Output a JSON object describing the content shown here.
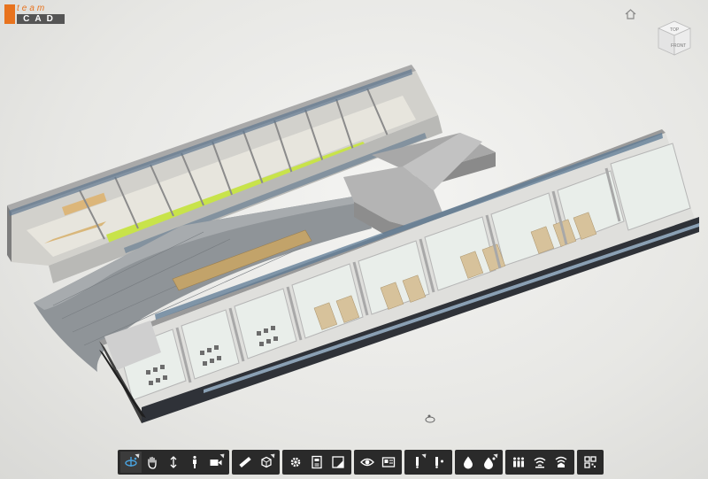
{
  "logo": {
    "word_top": "team",
    "word_bottom": "CAD"
  },
  "view_cube": {
    "top_label": "TOP",
    "front_label": "FRONT"
  },
  "toolbar": {
    "groups": [
      {
        "tools": [
          "orbit-icon",
          "pan-icon",
          "zoom-icon",
          "walk-icon",
          "camera-icon"
        ]
      },
      {
        "tools": [
          "measure-icon",
          "section-box-icon"
        ]
      },
      {
        "tools": [
          "settings-icon",
          "properties-icon",
          "model-browser-icon"
        ]
      },
      {
        "tools": [
          "visibility-icon",
          "sheets-icon"
        ]
      },
      {
        "tools": [
          "marker-icon",
          "marker-list-icon"
        ]
      },
      {
        "tools": [
          "water-drop-icon",
          "water-drop-add-icon"
        ]
      },
      {
        "tools": [
          "people-icon",
          "wifi-icon",
          "wifi-alt-icon"
        ]
      },
      {
        "tools": [
          "qr-code-icon"
        ]
      }
    ],
    "active_tool": "orbit-icon",
    "colors": {
      "bar": "#2a2a2a",
      "icon": "#ffffff",
      "accent": "#4aa3df"
    }
  },
  "colors": {
    "logo_orange": "#e8731e",
    "logo_gray": "#555555",
    "highlight_green": "#c8e34a"
  }
}
